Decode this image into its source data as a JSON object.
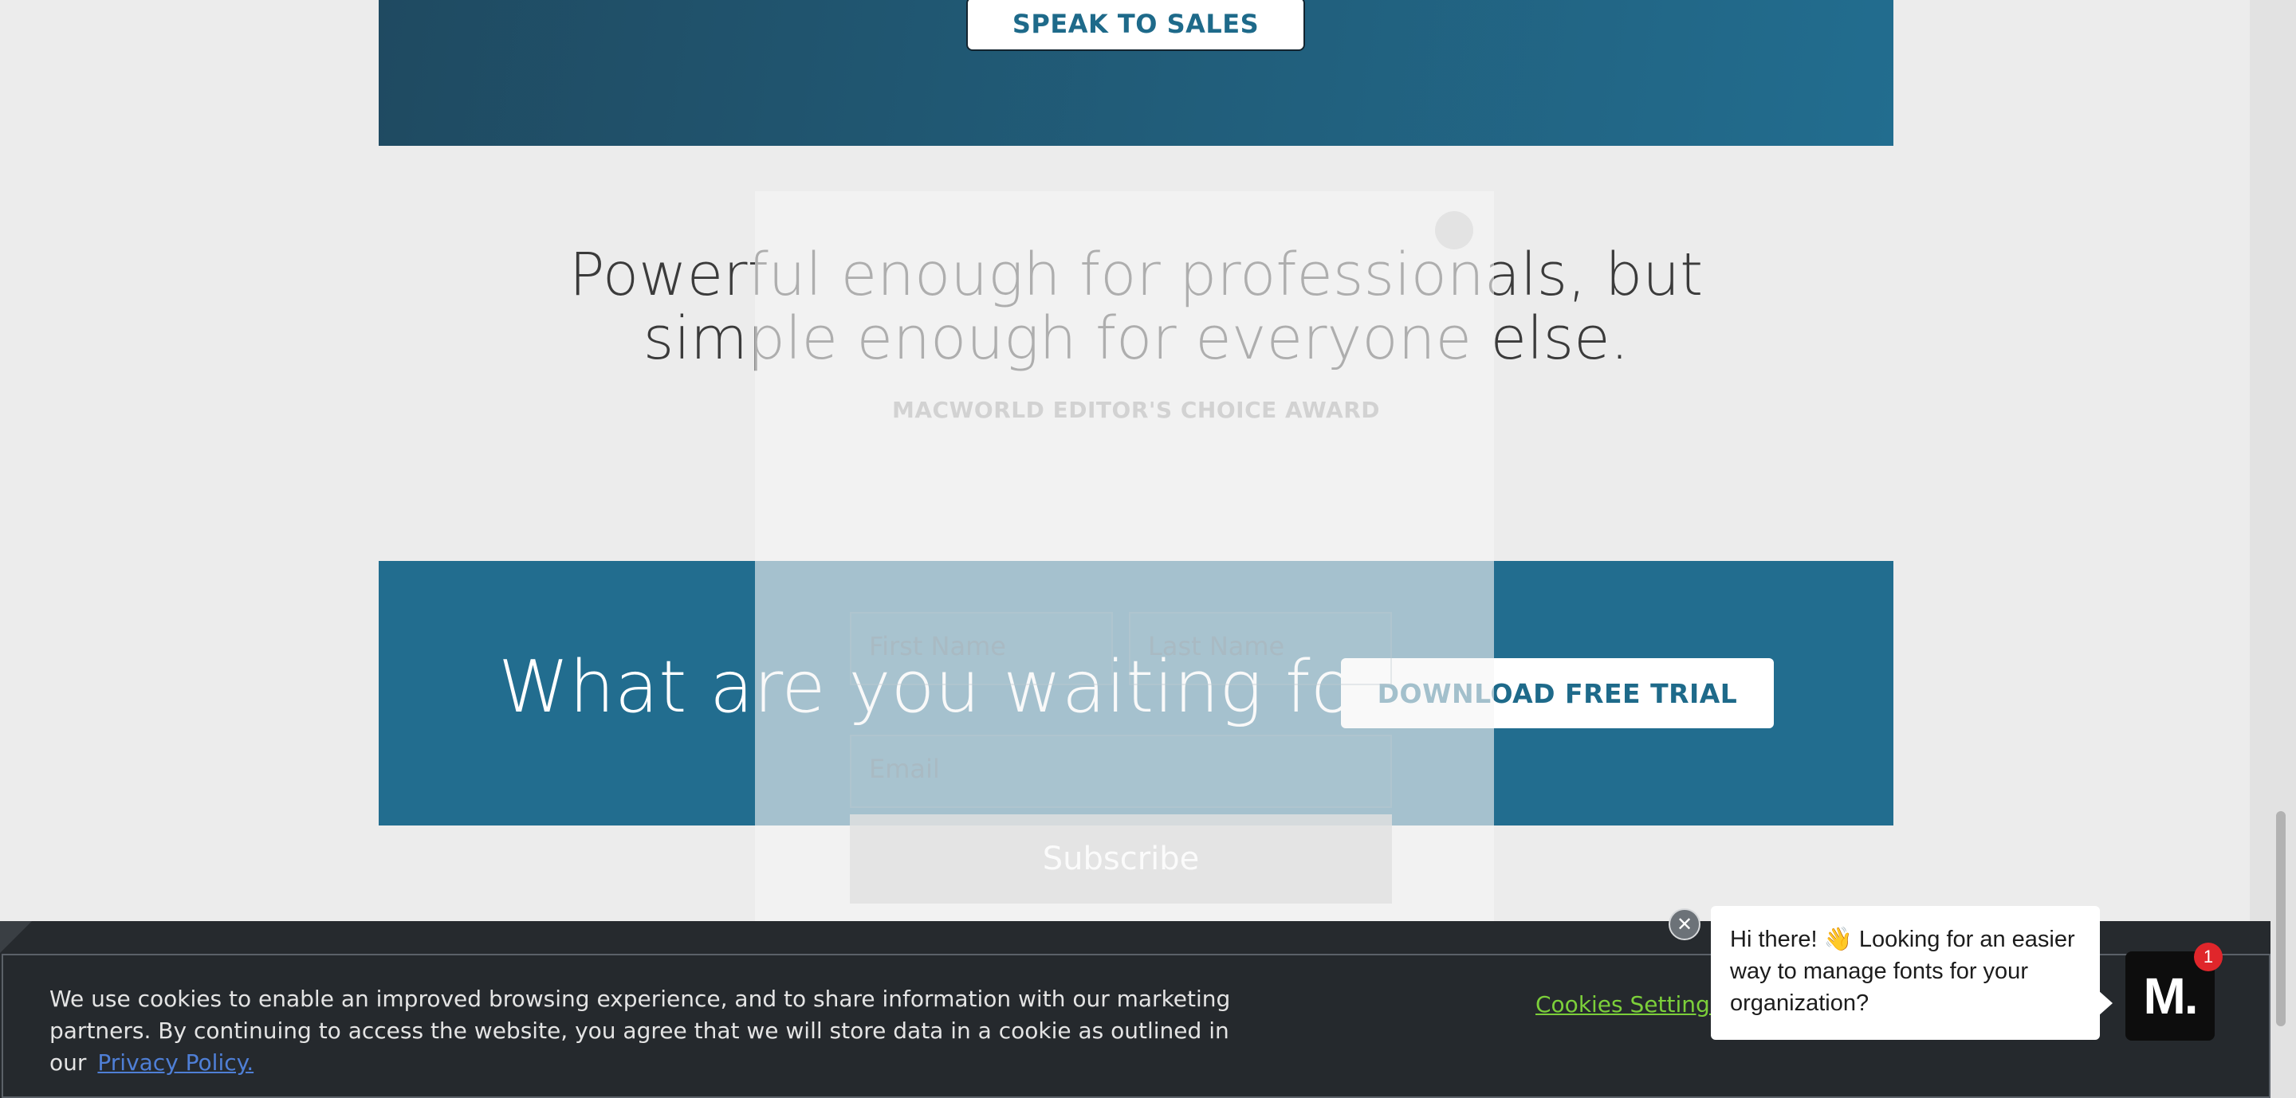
{
  "hero": {
    "speak_button": "SPEAK TO SALES"
  },
  "testimonial": {
    "quote_line1": "Powerful enough for professionals, but",
    "quote_line2": "simple enough for everyone else.",
    "source": "MACWORLD EDITOR'S CHOICE AWARD"
  },
  "cta": {
    "title": "What are you waiting for?",
    "button": "DOWNLOAD FREE TRIAL"
  },
  "signup_modal": {
    "first_name_placeholder": "First Name",
    "last_name_placeholder": "Last Name",
    "email_placeholder": "Email",
    "subscribe_label": "Subscribe"
  },
  "cookie_banner": {
    "text": "We use cookies to enable an improved browsing experience, and to share information with our marketing partners. By continuing to access the website, you agree that we will store data in a cookie as outlined in our",
    "privacy_link": "Privacy Policy.",
    "settings_link": "Cookies Settings"
  },
  "chat": {
    "message": "Hi there! 👋 Looking for an easier way to manage fonts for your organization?",
    "launcher_label": "M.",
    "badge_count": "1",
    "close_glyph": "✕"
  },
  "colors": {
    "brand_blue": "#226d8f",
    "cookie_link_green": "#7ccf3a",
    "badge_red": "#e0262b"
  }
}
